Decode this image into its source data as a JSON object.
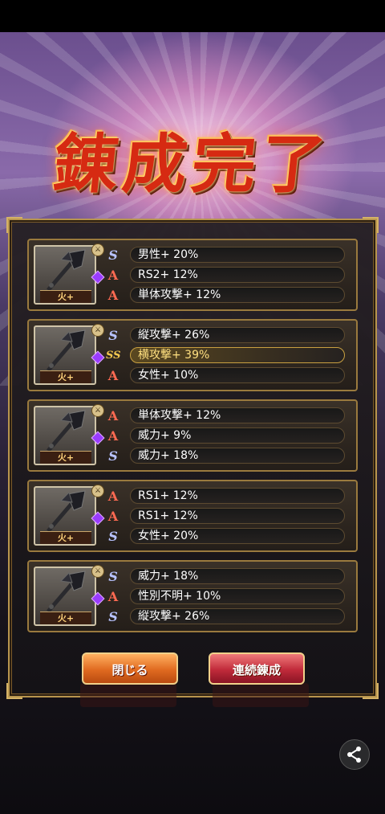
{
  "title": "錬成完了",
  "results": [
    {
      "element": "火+",
      "stats": [
        {
          "icon": "S",
          "text": "男性+ 20%",
          "highlight": false
        },
        {
          "icon": "A",
          "text": "RS2+ 12%",
          "highlight": false
        },
        {
          "icon": "A",
          "text": "単体攻撃+ 12%",
          "highlight": false
        }
      ]
    },
    {
      "element": "火+",
      "stats": [
        {
          "icon": "S",
          "text": "縦攻撃+ 26%",
          "highlight": false
        },
        {
          "icon": "SS",
          "text": "横攻撃+ 39%",
          "highlight": true
        },
        {
          "icon": "A",
          "text": "女性+ 10%",
          "highlight": false
        }
      ]
    },
    {
      "element": "火+",
      "stats": [
        {
          "icon": "A",
          "text": "単体攻撃+ 12%",
          "highlight": false
        },
        {
          "icon": "A",
          "text": "威力+ 9%",
          "highlight": false
        },
        {
          "icon": "S",
          "text": "威力+ 18%",
          "highlight": false
        }
      ]
    },
    {
      "element": "火+",
      "stats": [
        {
          "icon": "A",
          "text": "RS1+ 12%",
          "highlight": false
        },
        {
          "icon": "A",
          "text": "RS1+ 12%",
          "highlight": false
        },
        {
          "icon": "S",
          "text": "女性+ 20%",
          "highlight": false
        }
      ]
    },
    {
      "element": "火+",
      "stats": [
        {
          "icon": "S",
          "text": "威力+ 18%",
          "highlight": false
        },
        {
          "icon": "A",
          "text": "性別不明+ 10%",
          "highlight": false
        },
        {
          "icon": "S",
          "text": "縦攻撃+ 26%",
          "highlight": false
        }
      ]
    }
  ],
  "buttons": {
    "close": "閉じる",
    "again": "連続錬成"
  },
  "icons": {
    "share": "share-icon",
    "weapon": "axe-weapon-icon"
  },
  "colors": {
    "s_rank": "#b7c2ff",
    "a_rank": "#ff6a52",
    "ss_rank": "#f3c850",
    "frame": "#b8954e"
  }
}
